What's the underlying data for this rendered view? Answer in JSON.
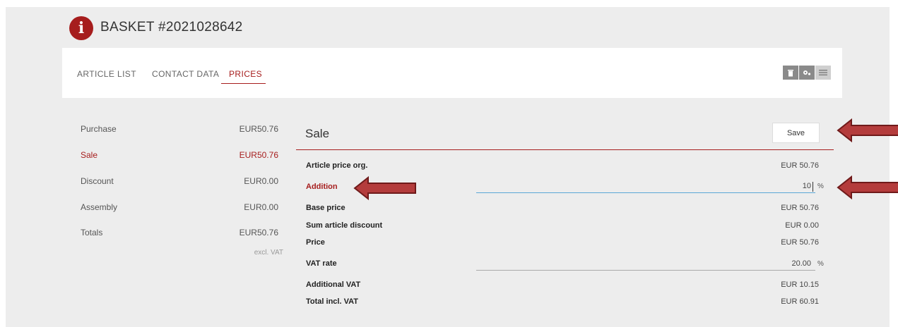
{
  "header": {
    "title": "BASKET #2021028642",
    "icon": "info-icon"
  },
  "tabs": [
    {
      "label": "ARTICLE LIST",
      "active": false
    },
    {
      "label": "CONTACT DATA",
      "active": false
    },
    {
      "label": "PRICES",
      "active": true
    }
  ],
  "toolbar": {
    "icons": [
      "trash-icon",
      "settings-icon",
      "list-icon"
    ]
  },
  "sidebar": {
    "items": [
      {
        "label": "Purchase",
        "value": "EUR50.76",
        "active": false
      },
      {
        "label": "Sale",
        "value": "EUR50.76",
        "active": true
      },
      {
        "label": "Discount",
        "value": "EUR0.00",
        "active": false
      },
      {
        "label": "Assembly",
        "value": "EUR0.00",
        "active": false
      },
      {
        "label": "Totals",
        "value": "EUR50.76",
        "active": false
      }
    ],
    "note": "excl. VAT"
  },
  "sale": {
    "title": "Sale",
    "save_label": "Save",
    "rows": {
      "article_price_org": {
        "label": "Article price org.",
        "value": "EUR 50.76"
      },
      "addition": {
        "label": "Addition",
        "value": "10",
        "unit": "%"
      },
      "base_price": {
        "label": "Base price",
        "value": "EUR 50.76"
      },
      "sum_article_discount": {
        "label": "Sum article discount",
        "value": "EUR 0.00"
      },
      "price": {
        "label": "Price",
        "value": "EUR 50.76"
      },
      "vat_rate": {
        "label": "VAT rate",
        "value": "20.00",
        "unit": "%"
      },
      "additional_vat": {
        "label": "Additional VAT",
        "value": "EUR 10.15"
      },
      "total_incl_vat": {
        "label": "Total incl. VAT",
        "value": "EUR 60.91"
      }
    }
  },
  "colors": {
    "accent": "#a61d1d",
    "input_focus": "#5aa7d6",
    "background": "#ededed"
  }
}
